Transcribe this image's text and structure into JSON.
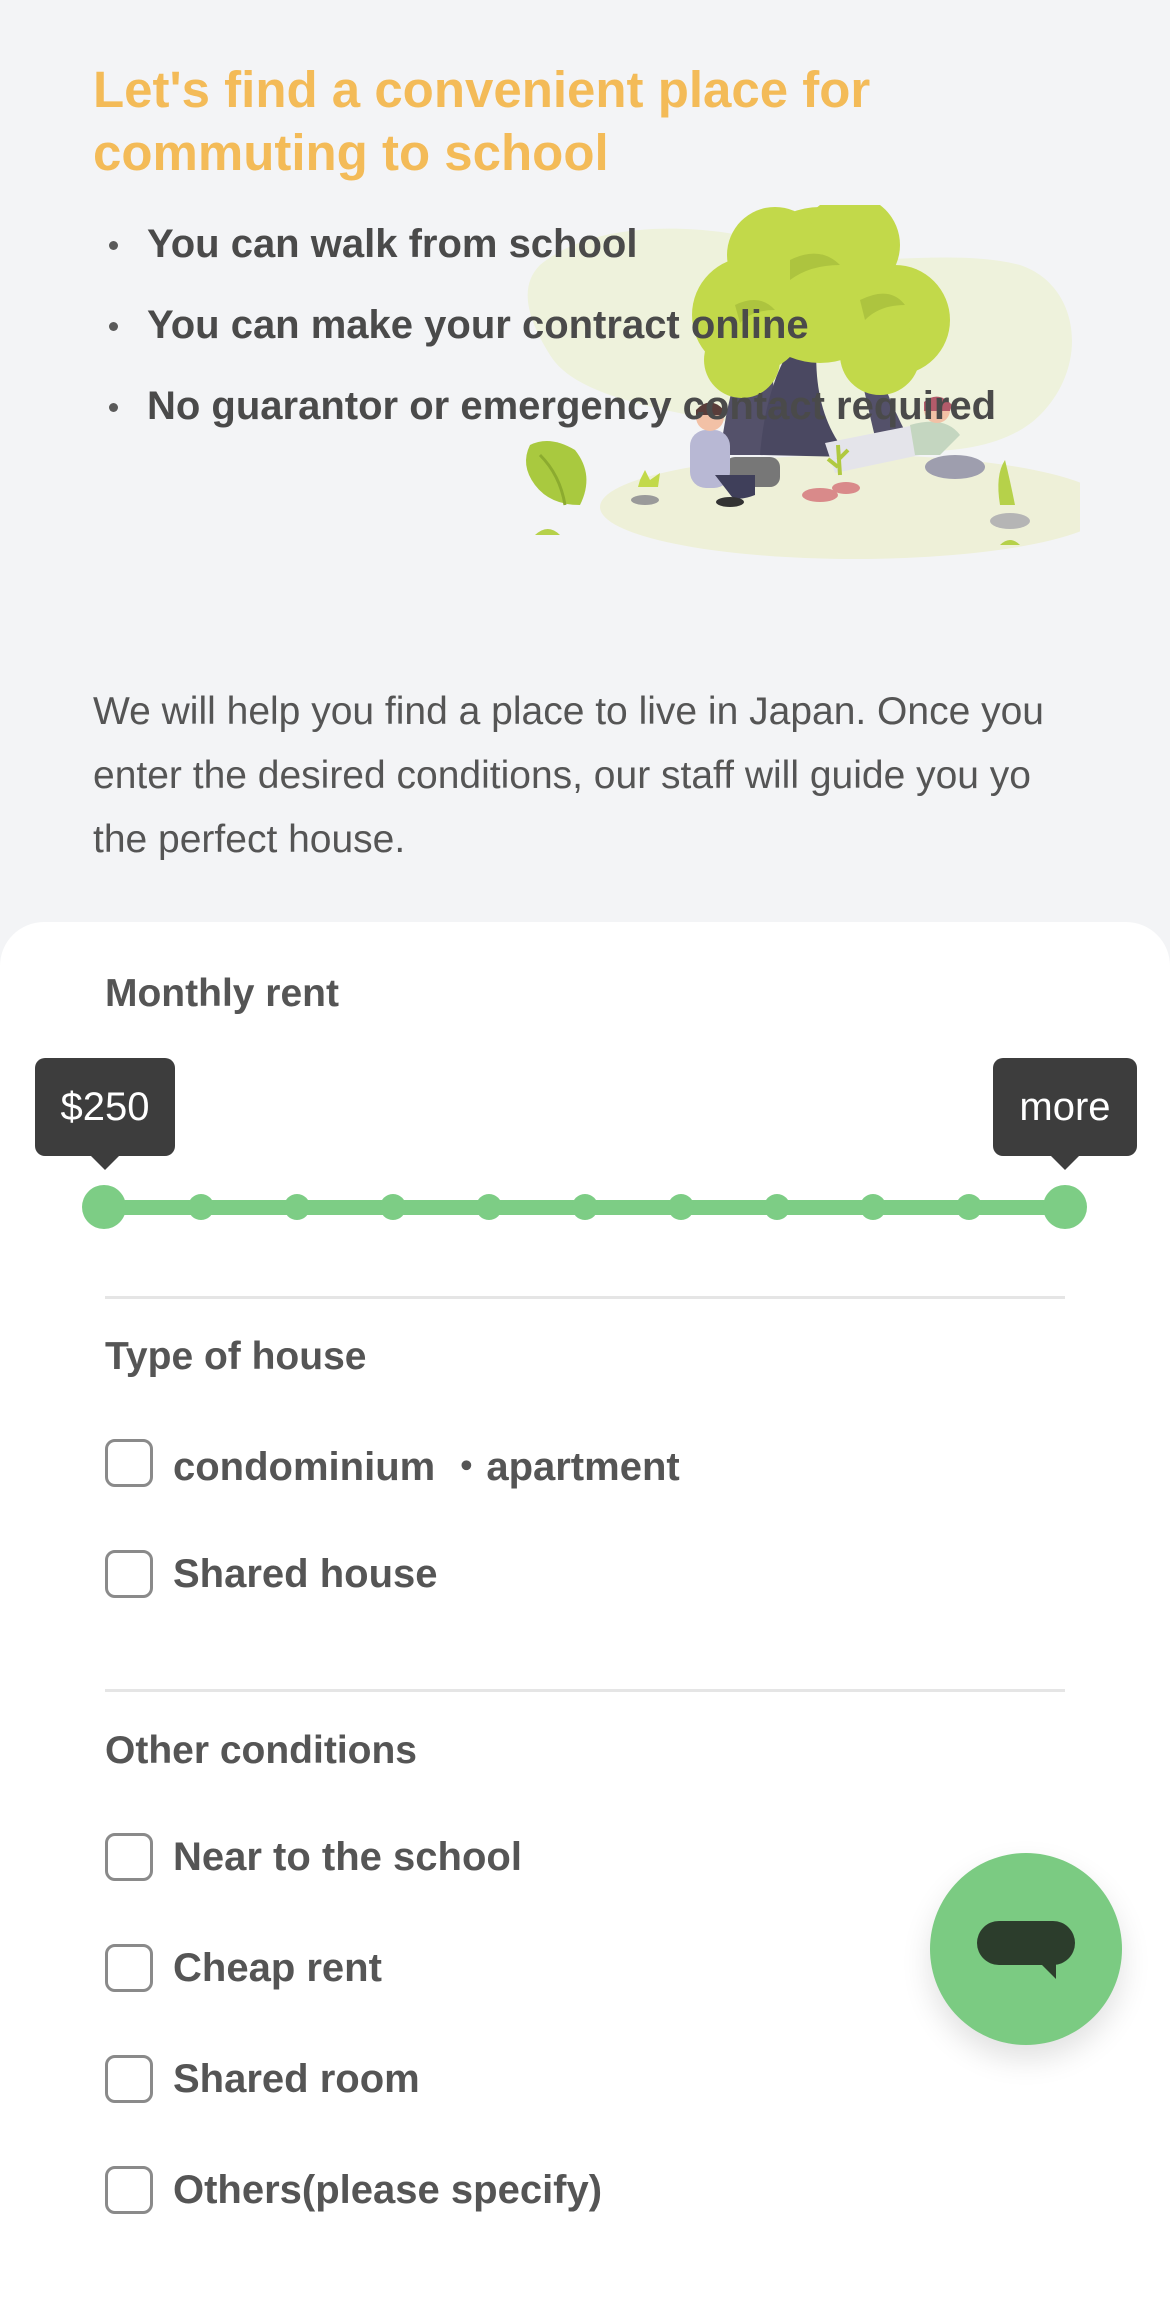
{
  "hero": {
    "title": "Let's find a convenient place for commuting to school",
    "bullets": [
      "You can walk from school",
      "You can make your contract online",
      "No guarantor or emergency contact required"
    ],
    "intro": "We will help you find a place to live in Japan. Once you enter the desired conditions, our staff will guide you yo the perfect house."
  },
  "form": {
    "rent": {
      "title": "Monthly rent",
      "min_label": "$250",
      "max_label": "more",
      "steps": 11
    },
    "house_type": {
      "title": "Type of house",
      "options": [
        {
          "label": "condominium ・apartment",
          "checked": false
        },
        {
          "label": "Shared house",
          "checked": false
        }
      ]
    },
    "other": {
      "title": "Other conditions",
      "options": [
        {
          "label": "Near to the school",
          "checked": false
        },
        {
          "label": "Cheap rent",
          "checked": false
        },
        {
          "label": "Shared room",
          "checked": false
        },
        {
          "label": "Others(please specify)",
          "checked": false
        }
      ]
    }
  },
  "colors": {
    "accent_title": "#f3bb58",
    "slider_green": "#7dcd85",
    "fab_green": "#7bcb82",
    "tooltip_bg": "#3d3d3d"
  },
  "icons": {
    "chat_button": "chat-bubble-icon"
  }
}
